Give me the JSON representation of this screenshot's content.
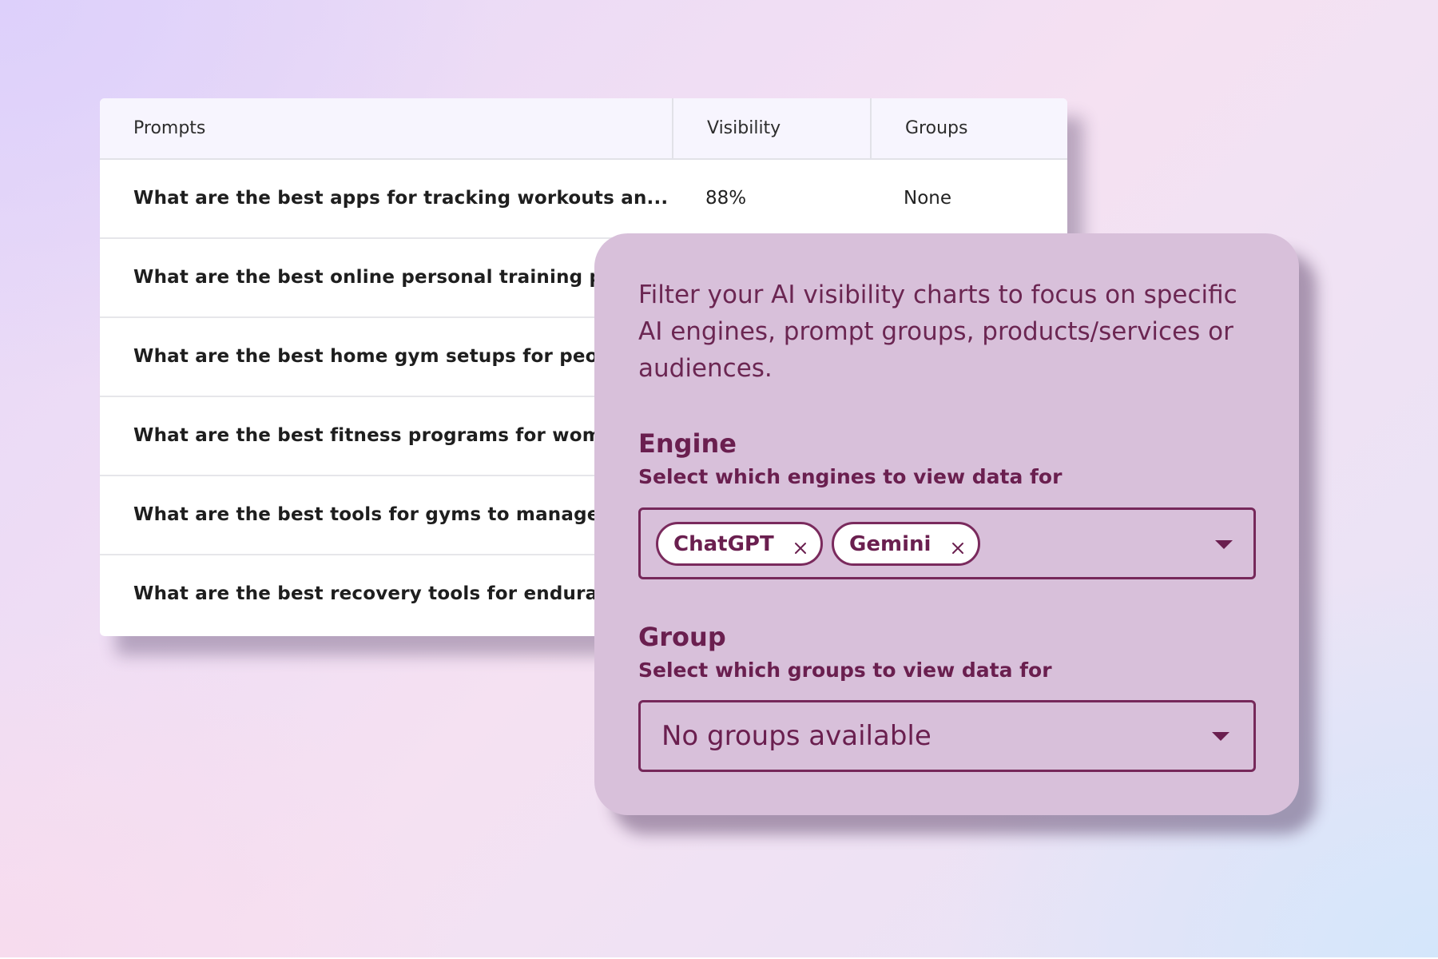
{
  "table": {
    "headers": {
      "prompts": "Prompts",
      "visibility": "Visibility",
      "groups": "Groups"
    },
    "rows": [
      {
        "prompt": "What are the best apps for tracking workouts an...",
        "visibility": "88%",
        "groups": "None"
      },
      {
        "prompt": "What are the best online personal training platforms",
        "visibility": "",
        "groups": ""
      },
      {
        "prompt": "What are the best home gym setups for people",
        "visibility": "",
        "groups": ""
      },
      {
        "prompt": "What are the best fitness programs for women",
        "visibility": "",
        "groups": ""
      },
      {
        "prompt": "What are the best tools for gyms to manage members",
        "visibility": "",
        "groups": ""
      },
      {
        "prompt": "What are the best recovery tools for endurance",
        "visibility": "",
        "groups": ""
      }
    ]
  },
  "filter_panel": {
    "description": "Filter your AI visibility charts to focus on specific AI engines, prompt groups, products/services or audiences.",
    "engine": {
      "title": "Engine",
      "subtitle": "Select which engines to view data for",
      "selected": [
        {
          "label": "ChatGPT",
          "remove_icon": "close-icon"
        },
        {
          "label": "Gemini",
          "remove_icon": "close-icon"
        }
      ],
      "dropdown_icon": "caret-down-icon"
    },
    "group": {
      "title": "Group",
      "subtitle": "Select which groups to view data for",
      "placeholder": "No groups available",
      "dropdown_icon": "caret-down-icon"
    }
  },
  "colors": {
    "panel_background": "#d8c0da",
    "accent": "#6a1f4f",
    "table_header_background": "#f7f5fe"
  }
}
